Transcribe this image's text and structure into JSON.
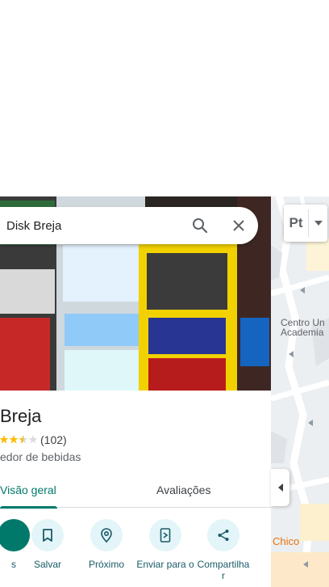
{
  "search": {
    "query": "Disk Breja"
  },
  "map": {
    "labels": {
      "center": [
        "Centro Un",
        "Academia"
      ],
      "chico": "Chico"
    }
  },
  "layer_control": {
    "language_glyph": "Pt"
  },
  "place": {
    "name": "Breja",
    "rating": 2.5,
    "review_count": "(102)",
    "category": "edor de bebidas"
  },
  "tabs": [
    {
      "label": "Visão geral",
      "active": true
    },
    {
      "label": "Avaliações",
      "active": false
    }
  ],
  "actions": [
    {
      "label": "s",
      "icon": "directions-icon"
    },
    {
      "label": "Salvar",
      "icon": "bookmark-icon"
    },
    {
      "label": "Próximo",
      "icon": "nearby-icon"
    },
    {
      "label": "Enviar para o",
      "icon": "send-to-phone-icon"
    },
    {
      "label": "Compartilha r",
      "icon": "share-icon"
    }
  ],
  "colors": {
    "accent": "#00796b",
    "action_bg": "#e3f5f8",
    "action_text": "#1a5b68"
  }
}
